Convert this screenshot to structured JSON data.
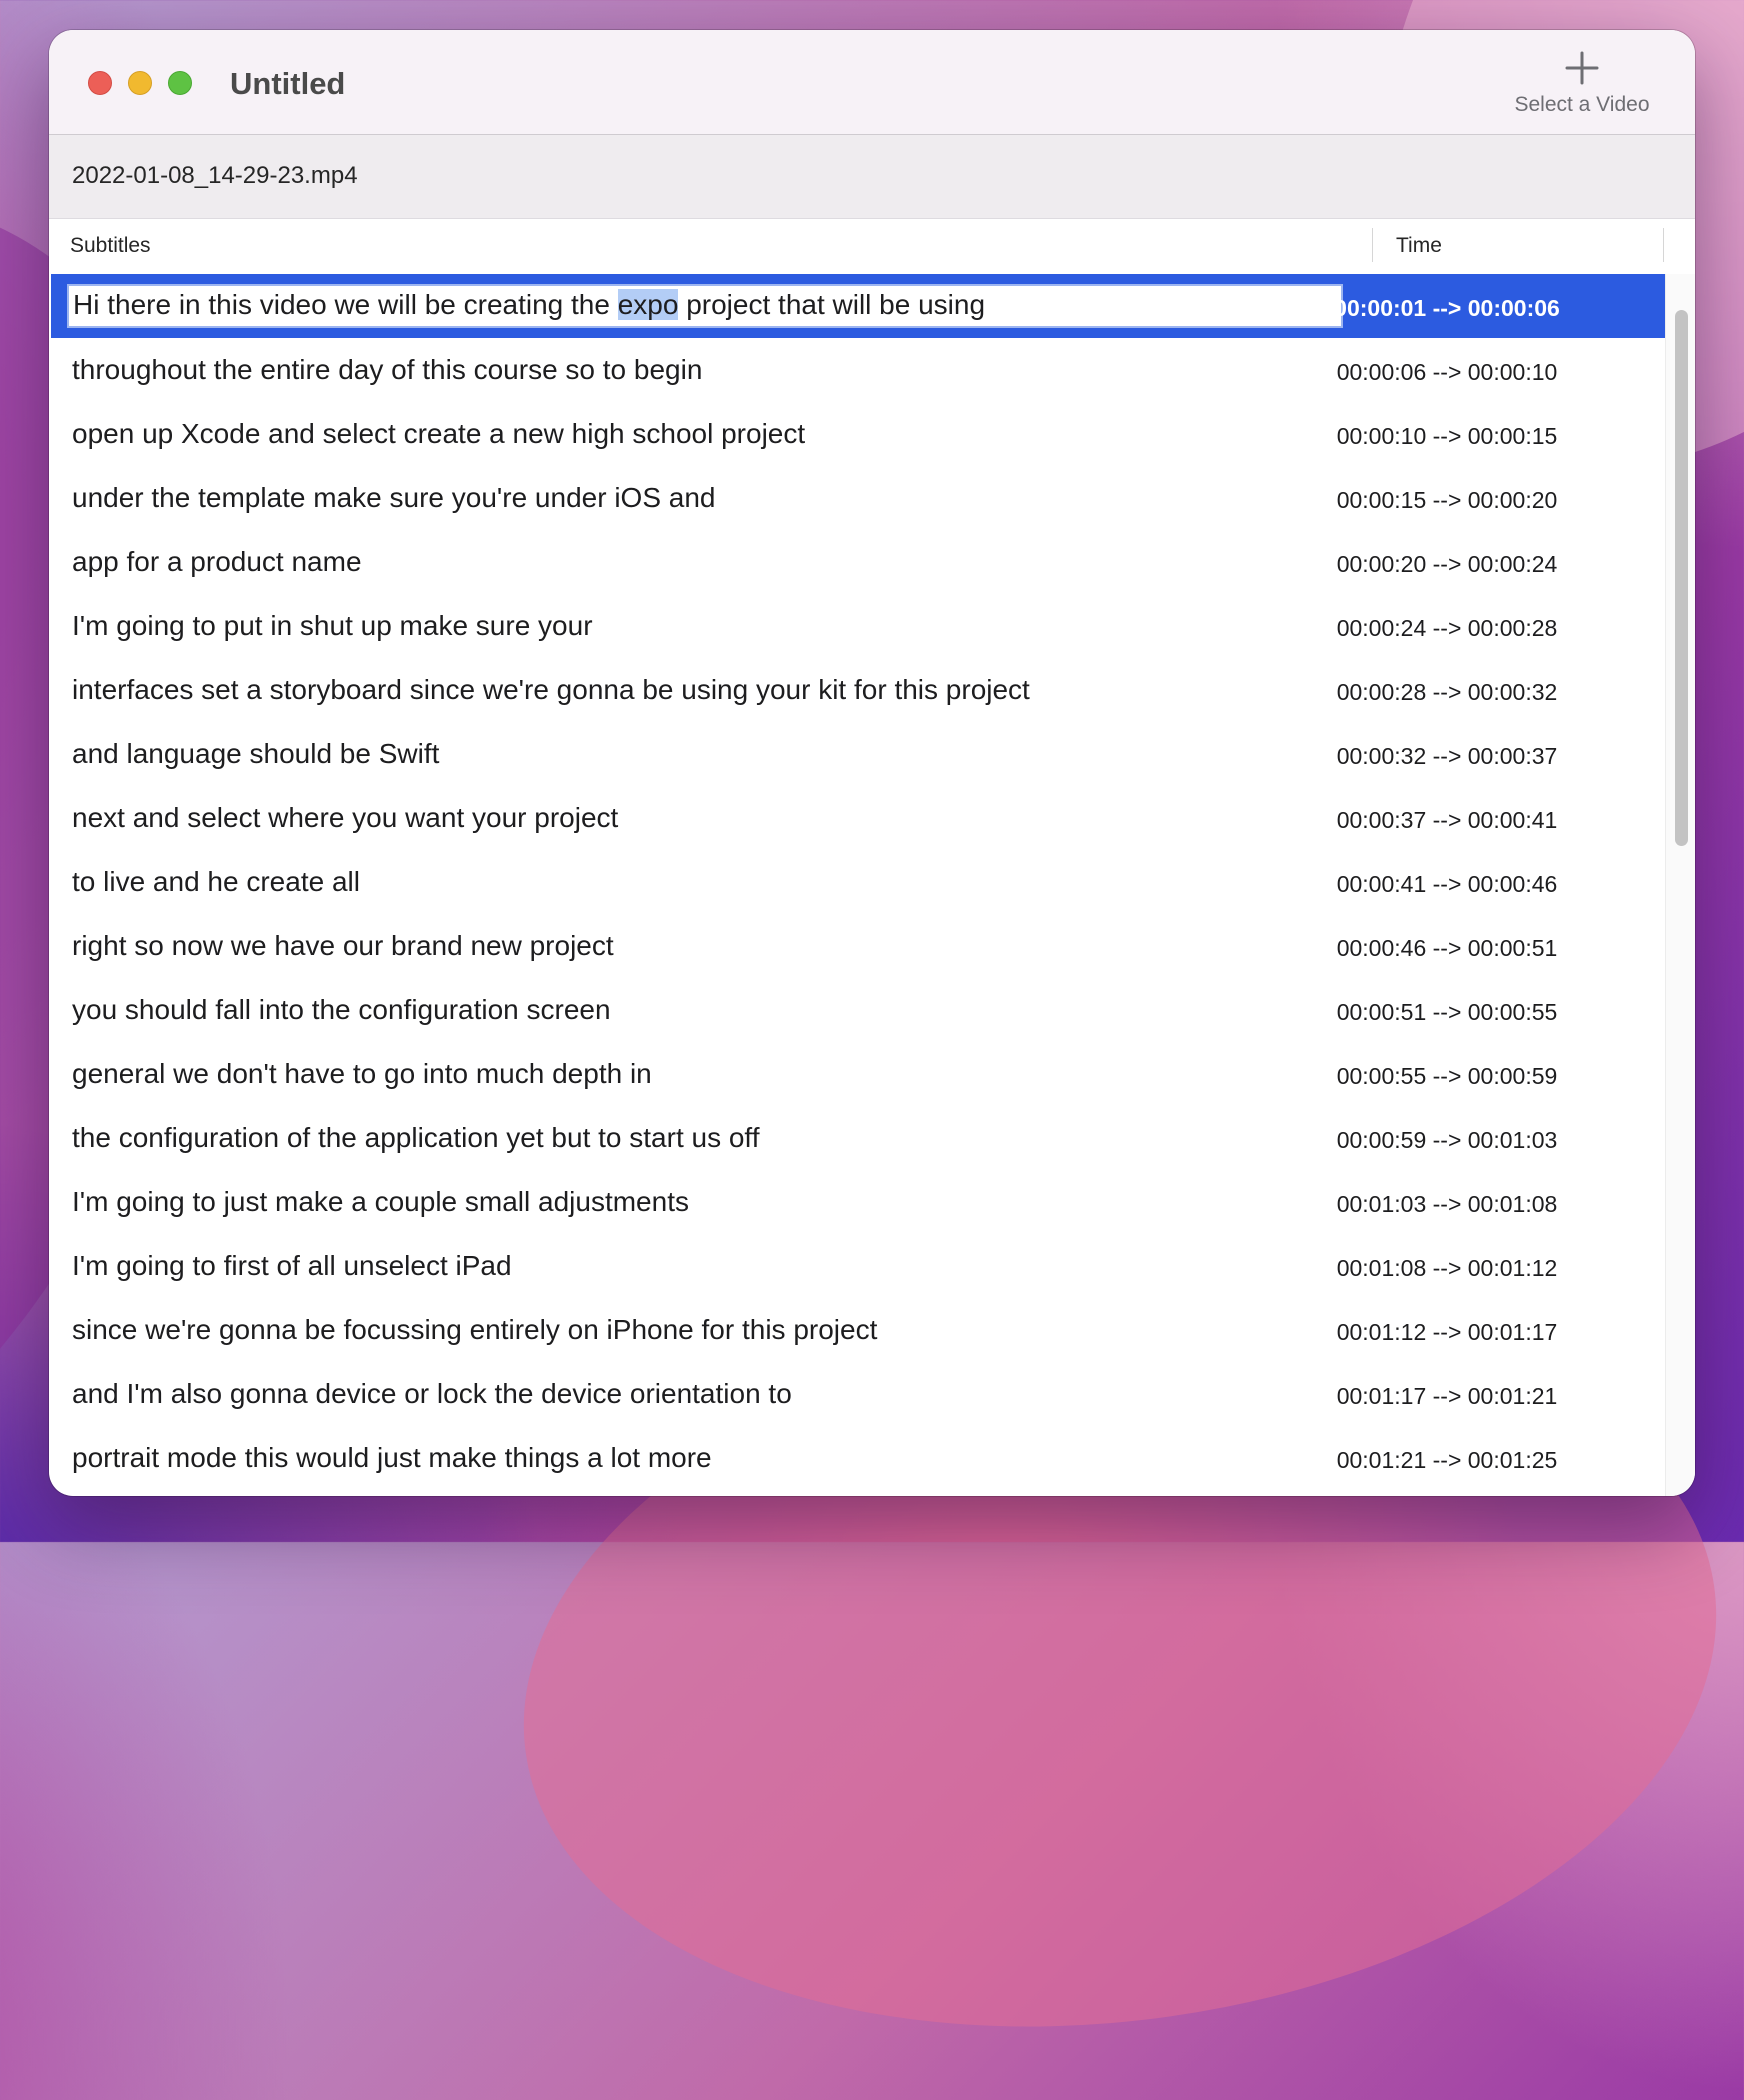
{
  "window": {
    "title": "Untitled",
    "controls": [
      "close",
      "minimize",
      "zoom"
    ]
  },
  "toolbar": {
    "select_video": {
      "icon": "plus-icon",
      "label": "Select a Video"
    }
  },
  "file": {
    "name": "2022-01-08_14-29-23.mp4"
  },
  "table": {
    "columns": {
      "subtitles": "Subtitles",
      "time": "Time"
    },
    "selected_row": 0,
    "editing": {
      "before": "Hi there in this video we will be creating the ",
      "highlighted": "expo",
      "after": " project that will be using"
    },
    "rows": [
      {
        "text": "Hi there in this video we will be creating the expo project that will be using",
        "time": "00:00:01 --> 00:00:06"
      },
      {
        "text": "throughout the entire day of this course so to begin",
        "time": "00:00:06 --> 00:00:10"
      },
      {
        "text": "open up Xcode and select create a new high school project",
        "time": "00:00:10 --> 00:00:15"
      },
      {
        "text": "under the template make sure you're under iOS and",
        "time": "00:00:15 --> 00:00:20"
      },
      {
        "text": "app for a product name",
        "time": "00:00:20 --> 00:00:24"
      },
      {
        "text": "I'm going to put in shut up make sure your",
        "time": "00:00:24 --> 00:00:28"
      },
      {
        "text": "interfaces set a storyboard since we're gonna be using your kit for this project",
        "time": "00:00:28 --> 00:00:32"
      },
      {
        "text": "and language should be Swift",
        "time": "00:00:32 --> 00:00:37"
      },
      {
        "text": "next and select where you want your project",
        "time": "00:00:37 --> 00:00:41"
      },
      {
        "text": "to live and he create all",
        "time": "00:00:41 --> 00:00:46"
      },
      {
        "text": "right so now we have our brand new project",
        "time": "00:00:46 --> 00:00:51"
      },
      {
        "text": "you should fall into the configuration screen",
        "time": "00:00:51 --> 00:00:55"
      },
      {
        "text": "general we don't have to go into much depth in",
        "time": "00:00:55 --> 00:00:59"
      },
      {
        "text": "the configuration of the application yet but to start us off",
        "time": "00:00:59 --> 00:01:03"
      },
      {
        "text": "I'm going to just make a couple small adjustments",
        "time": "00:01:03 --> 00:01:08"
      },
      {
        "text": "I'm going to first of all unselect iPad",
        "time": "00:01:08 --> 00:01:12"
      },
      {
        "text": "since we're gonna be focussing entirely on iPhone for this project",
        "time": "00:01:12 --> 00:01:17"
      },
      {
        "text": "and I'm also gonna device or lock the device orientation to",
        "time": "00:01:17 --> 00:01:21"
      },
      {
        "text": "portrait mode this would just make things a lot more",
        "time": "00:01:21 --> 00:01:25"
      }
    ]
  },
  "colors": {
    "selection": "#2c5be0",
    "text_highlight": "#b3cdf6",
    "close": "#ec5f57",
    "minimize": "#f1b92f",
    "zoom": "#5ec243"
  }
}
